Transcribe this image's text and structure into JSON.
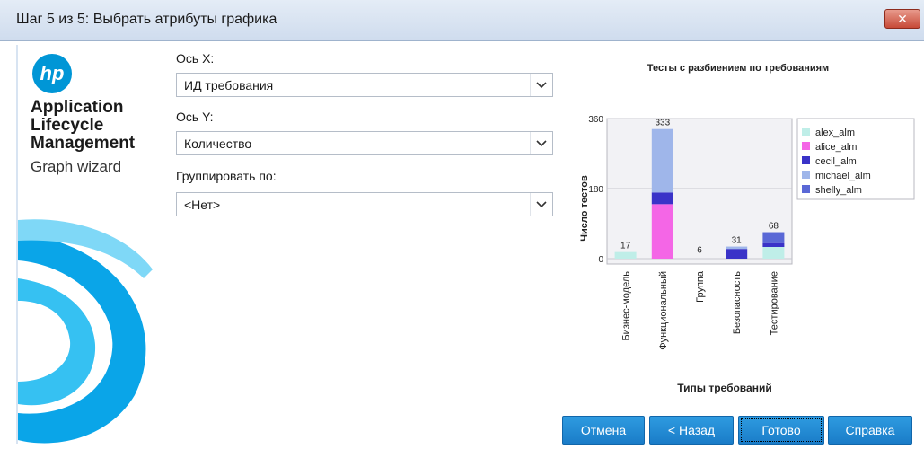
{
  "window": {
    "title": "Шаг 5 из 5: Выбрать атрибуты графика",
    "close_glyph": "✕"
  },
  "side_panel": {
    "logo_text": "hp",
    "app_name_lines": [
      "Application",
      "Lifecycle",
      "Management"
    ],
    "subtitle": "Graph wizard"
  },
  "form": {
    "x_axis": {
      "label": "Ось X:",
      "value": "ИД требования"
    },
    "y_axis": {
      "label": "Ось Y:",
      "value": "Количество"
    },
    "group_by": {
      "label": "Группировать по:",
      "value": "<Нет>"
    }
  },
  "buttons": {
    "cancel": "Отмена",
    "back": "< Назад",
    "finish": "Готово",
    "help": "Справка"
  },
  "colors": {
    "alex_alm": "#bfeee8",
    "alice_alm": "#f466e6",
    "cecil_alm": "#3a33c8",
    "michael_alm": "#9fb6ea",
    "shelly_alm": "#5a68d6"
  },
  "chart_data": {
    "type": "bar",
    "stacked": true,
    "title": "Тесты с разбиением по требованиям",
    "xlabel": "Типы требований",
    "ylabel": "Число тестов",
    "ylim": [
      0,
      360
    ],
    "yticks": [
      0,
      180,
      360
    ],
    "categories": [
      "Бизнес-модель",
      "Функциональный",
      "Группа",
      "Безопасность",
      "Тестирование"
    ],
    "totals": [
      17,
      333,
      6,
      31,
      68
    ],
    "series": [
      {
        "name": "alex_alm",
        "values": [
          17,
          0,
          0,
          0,
          30
        ]
      },
      {
        "name": "alice_alm",
        "values": [
          0,
          140,
          0,
          0,
          0
        ]
      },
      {
        "name": "cecil_alm",
        "values": [
          0,
          30,
          0,
          25,
          10
        ]
      },
      {
        "name": "michael_alm",
        "values": [
          0,
          163,
          0,
          6,
          0
        ]
      },
      {
        "name": "shelly_alm",
        "values": [
          0,
          0,
          0,
          0,
          28
        ]
      }
    ],
    "legend_position": "right"
  }
}
